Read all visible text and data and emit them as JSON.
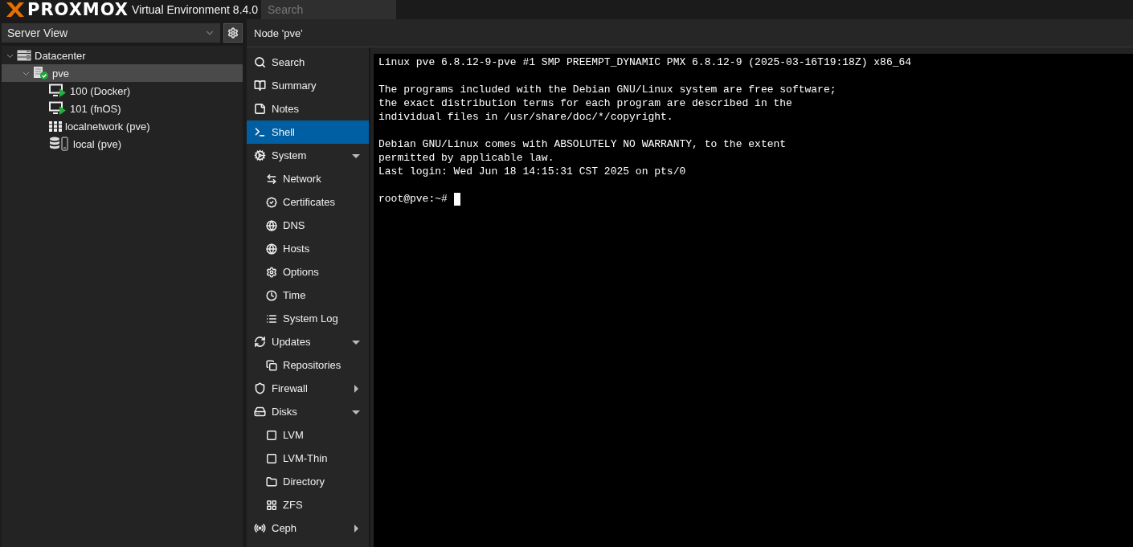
{
  "header": {
    "logo": "PROXMOX",
    "product": "Virtual Environment 8.4.0",
    "search": {
      "placeholder": "Search"
    }
  },
  "view_selector": {
    "value": "Server View"
  },
  "tree": [
    {
      "label": "Datacenter",
      "expanded": true,
      "selected": false,
      "children": [
        {
          "label": "pve",
          "expanded": true,
          "selected": true,
          "children": [
            {
              "label": "100 (Docker)",
              "selected": false
            },
            {
              "label": "101 (fnOS)",
              "selected": false
            },
            {
              "label": "localnetwork (pve)",
              "selected": false
            },
            {
              "label": "local (pve)",
              "selected": false
            }
          ]
        }
      ]
    }
  ],
  "panel": {
    "title": "Node 'pve'"
  },
  "nav": [
    {
      "label": "Search",
      "kind": "link",
      "selected": false
    },
    {
      "label": "Summary",
      "kind": "link",
      "selected": false
    },
    {
      "label": "Notes",
      "kind": "link",
      "selected": false
    },
    {
      "label": "Shell",
      "kind": "link",
      "selected": true
    },
    {
      "label": "System",
      "kind": "group",
      "expanded": true,
      "selected": false,
      "children": [
        {
          "label": "Network",
          "selected": false
        },
        {
          "label": "Certificates",
          "selected": false
        },
        {
          "label": "DNS",
          "selected": false
        },
        {
          "label": "Hosts",
          "selected": false
        },
        {
          "label": "Options",
          "selected": false
        },
        {
          "label": "Time",
          "selected": false
        },
        {
          "label": "System Log",
          "selected": false
        }
      ]
    },
    {
      "label": "Updates",
      "kind": "group",
      "expanded": true,
      "selected": false,
      "children": [
        {
          "label": "Repositories",
          "selected": false
        }
      ]
    },
    {
      "label": "Firewall",
      "kind": "group",
      "expanded": false,
      "selected": false
    },
    {
      "label": "Disks",
      "kind": "group",
      "expanded": true,
      "selected": false,
      "children": [
        {
          "label": "LVM",
          "selected": false
        },
        {
          "label": "LVM-Thin",
          "selected": false
        },
        {
          "label": "Directory",
          "selected": false
        },
        {
          "label": "ZFS",
          "selected": false
        }
      ]
    },
    {
      "label": "Ceph",
      "kind": "group",
      "expanded": false,
      "selected": false
    }
  ],
  "terminal": {
    "paragraphs": [
      [
        "Linux pve 6.8.12-9-pve #1 SMP PREEMPT_DYNAMIC PMX 6.8.12-9 (2025-03-16T19:18Z) x86_64"
      ],
      [
        "The programs included with the Debian GNU/Linux system are free software;",
        "the exact distribution terms for each program are described in the",
        "individual files in /usr/share/doc/*/copyright."
      ],
      [
        "Debian GNU/Linux comes with ABSOLUTELY NO WARRANTY, to the extent",
        "permitted by applicable law.",
        "Last login: Wed Jun 18 14:15:31 CST 2025 on pts/0"
      ]
    ],
    "prompt": "root@pve:~#"
  }
}
